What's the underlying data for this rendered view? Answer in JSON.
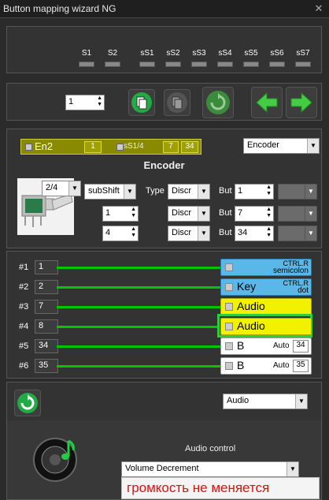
{
  "window": {
    "title": "Button mapping wizard NG",
    "close": "✕"
  },
  "switches": [
    "S1",
    "S2",
    "sS1",
    "sS2",
    "sS3",
    "sS4",
    "sS5",
    "sS6",
    "sS7"
  ],
  "toolbar": {
    "index_value": "1"
  },
  "encoder": {
    "bar_name": "En2",
    "bar_num1": "1",
    "bar_shift": "sS1/4",
    "bar_num2": "7",
    "bar_num3": "34",
    "type_select": "Encoder",
    "title": "Encoder",
    "mode_select": "2/4",
    "shift_select": "subShift",
    "type_label": "Type",
    "but_label": "But",
    "rows": [
      {
        "spin": "",
        "type": "Discr",
        "but": "1"
      },
      {
        "spin": "1",
        "type": "Discr",
        "but": "7"
      },
      {
        "spin": "4",
        "type": "Discr",
        "but": "34"
      }
    ]
  },
  "mapping": {
    "rows": [
      {
        "idx": "#1",
        "num": "1",
        "main": "",
        "line1": "CTRL.R",
        "line2": "semicolon"
      },
      {
        "idx": "#2",
        "num": "2",
        "main": "Key",
        "line1": "CTRL.R",
        "line2": "dot"
      },
      {
        "idx": "#3",
        "num": "7",
        "main": "Audio",
        "line1": "",
        "line2": ""
      },
      {
        "idx": "#4",
        "num": "8",
        "main": "Audio",
        "line1": "",
        "line2": ""
      },
      {
        "idx": "#5",
        "num": "34",
        "main": "B",
        "auto": "Auto",
        "autonum": "34"
      },
      {
        "idx": "#6",
        "num": "35",
        "main": "B",
        "auto": "Auto",
        "autonum": "35"
      }
    ]
  },
  "bottom": {
    "action_select": "Audio",
    "section_label": "Audio control",
    "control_select": "Volume Decrement",
    "notice": "громкость не меняется"
  },
  "colors": {
    "green_line": "#00c400",
    "blue_key": "#5ab8e8",
    "yellow_audio": "#f2f200",
    "highlight": "#2ecc40",
    "notice_text": "#e01010"
  }
}
